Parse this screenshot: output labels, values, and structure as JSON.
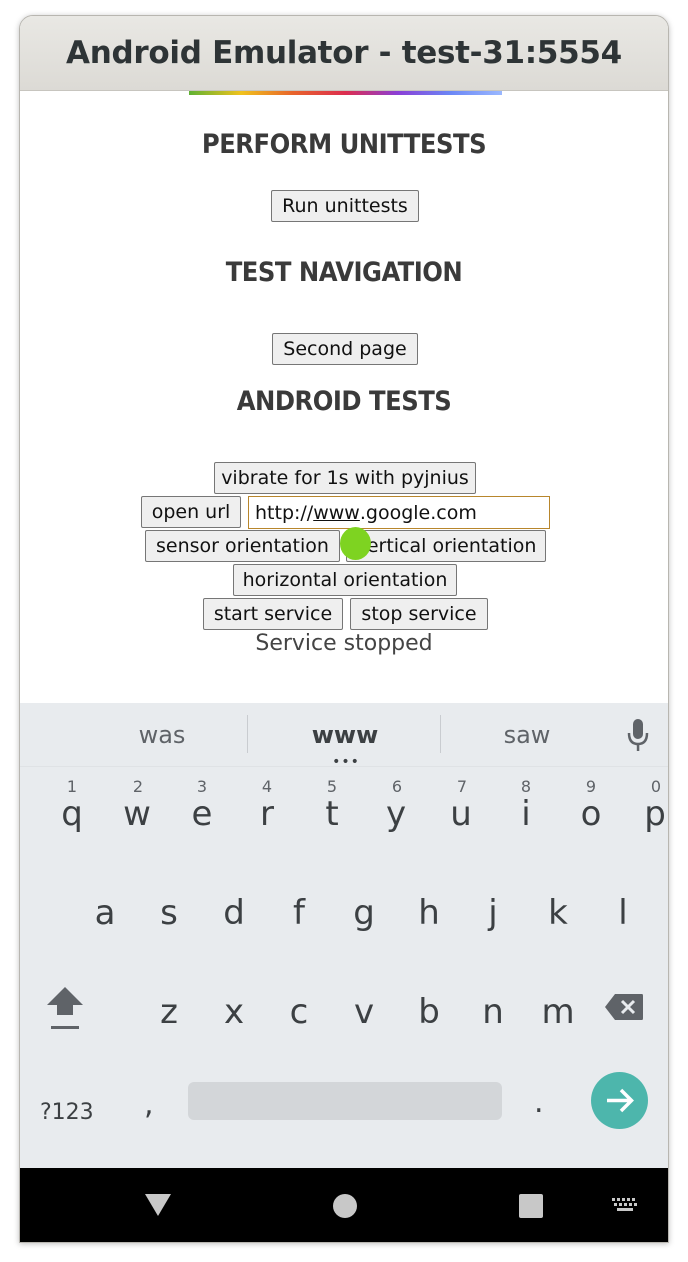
{
  "window": {
    "title": "Android Emulator - test-31:5554"
  },
  "app": {
    "headings": {
      "unittests": "Perform Unittests",
      "navigation": "Test Navigation",
      "android": "Android Tests"
    },
    "buttons": {
      "run_unittests": "Run unittests",
      "second_page": "Second page",
      "vibrate": "vibrate for 1s with pyjnius",
      "open_url": "open url",
      "sensor_orientation": "sensor orientation",
      "vertical_orientation": "vertical orientation",
      "horizontal_orientation": "horizontal orientation",
      "start_service": "start service",
      "stop_service": "stop service"
    },
    "url_input": {
      "prefix": "http://",
      "underlined": "www",
      "suffix": ".google.com"
    },
    "service_status": "Service stopped"
  },
  "keyboard": {
    "suggestions": [
      "was",
      "www",
      "saw"
    ],
    "more_indicator": "•••",
    "row1": [
      "q",
      "w",
      "e",
      "r",
      "t",
      "y",
      "u",
      "i",
      "o",
      "p"
    ],
    "row1_hints": [
      "1",
      "2",
      "3",
      "4",
      "5",
      "6",
      "7",
      "8",
      "9",
      "0"
    ],
    "row2": [
      "a",
      "s",
      "d",
      "f",
      "g",
      "h",
      "j",
      "k",
      "l"
    ],
    "row3": [
      "z",
      "x",
      "c",
      "v",
      "b",
      "n",
      "m"
    ],
    "symbols_key": "?123",
    "comma_key": ",",
    "period_key": ".",
    "accent_color": "#4db6ac"
  },
  "icons": {
    "mic": "microphone-icon",
    "shift": "shift-icon",
    "backspace": "backspace-icon",
    "enter": "arrow-right-icon",
    "nav_back": "back-triangle-icon",
    "nav_home": "home-circle-icon",
    "nav_recent": "recents-square-icon",
    "nav_keyboard": "keyboard-icon"
  }
}
